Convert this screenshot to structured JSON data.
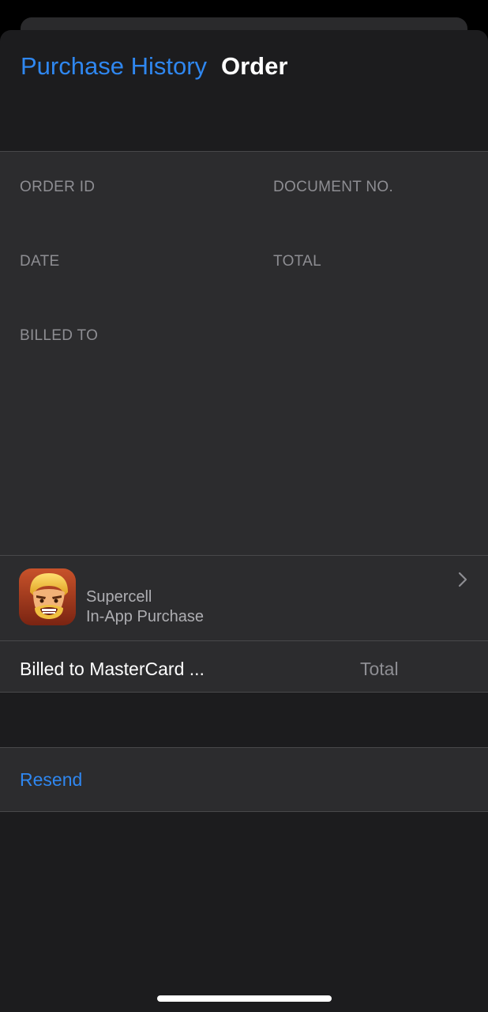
{
  "nav": {
    "back_label": "Purchase History",
    "title": "Order"
  },
  "info": {
    "order_id_label": "ORDER ID",
    "document_no_label": "DOCUMENT NO.",
    "date_label": "DATE",
    "total_label": "TOTAL",
    "billed_to_label": "BILLED TO"
  },
  "purchase": {
    "app_icon": "clash-of-clans-app-icon",
    "developer": "Supercell",
    "type": "In-App Purchase",
    "billed_to": "Billed to MasterCard ...",
    "total_label": "Total"
  },
  "actions": {
    "resend_label": "Resend"
  },
  "colors": {
    "accent": "#2f87f0",
    "background": "#1c1c1e",
    "card": "#2c2c2e"
  }
}
